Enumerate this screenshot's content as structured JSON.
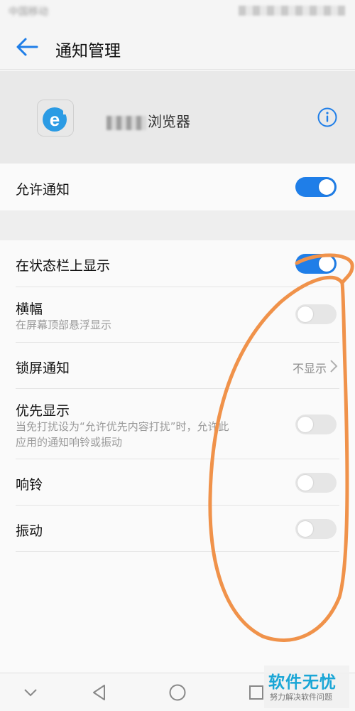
{
  "status_bar": {
    "carrier": "中国移动"
  },
  "app_bar": {
    "title": "通知管理",
    "back_icon": "arrow-left-icon"
  },
  "app_header": {
    "name_suffix": "浏览器",
    "info_icon": "info-circle-icon"
  },
  "allow_notifications": {
    "label": "允许通知",
    "enabled": true
  },
  "settings": {
    "status_bar_display": {
      "label": "在状态栏上显示",
      "enabled": true
    },
    "banner": {
      "label": "横幅",
      "sub": "在屏幕顶部悬浮显示",
      "enabled": false
    },
    "lock_screen": {
      "label": "锁屏通知",
      "value": "不显示"
    },
    "priority": {
      "label": "优先显示",
      "sub_line1": "当免打扰设为“允许优先内容打扰”时，允许此",
      "sub_line2": "应用的通知响铃或振动",
      "enabled": false
    },
    "ringtone": {
      "label": "响铃",
      "enabled": false
    },
    "vibrate": {
      "label": "振动",
      "enabled": false
    }
  },
  "nav_bar": {
    "icons": [
      "chevron-down-icon",
      "back-triangle-icon",
      "home-circle-icon",
      "recent-square-icon"
    ]
  },
  "watermark": {
    "main": "软件无忧",
    "sub": "努力解决软件问题"
  },
  "colors": {
    "accent": "#1f7ee8",
    "annotation": "#f0924a",
    "watermark": "#1aa6d6"
  }
}
